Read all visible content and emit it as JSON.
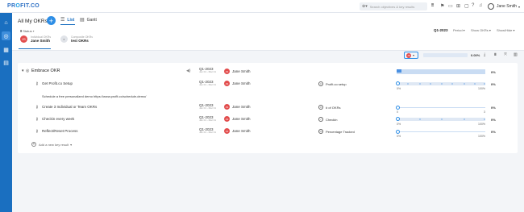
{
  "app": {
    "logo_main": "PR",
    "logo_accent": "O",
    "logo_rest": "FIT.CO"
  },
  "search": {
    "placeholder": "Search objectives & key results"
  },
  "topbar_icons": [
    "filter-icon",
    "flag-icon",
    "folder-icon",
    "grid-icon",
    "chat-icon",
    "help-icon",
    "bell-icon"
  ],
  "user": {
    "name": "Jane Smith"
  },
  "sidebar": {
    "items": [
      "home-icon",
      "target-icon",
      "calendar-icon",
      "message-icon"
    ]
  },
  "header": {
    "title": "All My OKRs",
    "tabs": [
      {
        "label": "List"
      },
      {
        "label": "Gantt"
      }
    ],
    "filter_status": "Status",
    "owners": [
      {
        "label": "Individual OKRs",
        "name": "Jane Smith",
        "initials": "JS"
      },
      {
        "label": "Composite OKRs",
        "name": "test OKRs",
        "initials": ""
      }
    ],
    "period_selected": "Q1-2023",
    "period_label": "Period",
    "show_okrs": "Show OKRs",
    "show_hide": "Show/Hide"
  },
  "toolbar": {
    "mini_initials": "JS",
    "overall_progress": 0,
    "overall_pct": "0.00%"
  },
  "objective": {
    "title": "Embrace OKR",
    "period": "Q1-2023",
    "period_range": "Jan 01 - Mar 31",
    "owner": "Jane Smith",
    "owner_initials": "JS",
    "progress": 0,
    "pct": "0%"
  },
  "key_results": [
    {
      "title": "Get Profit.co Setup",
      "period": "Q1-2023",
      "period_range": "Jan 01 - Mar 31",
      "owner": "Jane Smith",
      "owner_initials": "JS",
      "metric": "Profit.co setup",
      "progress": 0,
      "min": "0%",
      "max": "100%",
      "pct": "0%",
      "note": "Schedule a free personalized demo https://www.profit.co/schedule-demo/"
    },
    {
      "title": "Create 3 Individual or Team OKRs",
      "period": "Q1-2023",
      "period_range": "Jan 01 - Mar 31",
      "owner": "Jane Smith",
      "owner_initials": "JS",
      "metric": "# of OKRs",
      "progress": 0,
      "min": "0",
      "max": "3",
      "pct": "0%"
    },
    {
      "title": "Checkin every week",
      "period": "Q1-2023",
      "period_range": "Jan 01 - Mar 31",
      "owner": "Jane Smith",
      "owner_initials": "JS",
      "metric": "Checkin",
      "progress": 0,
      "min": "0%",
      "max": "100%",
      "pct": "0%"
    },
    {
      "title": "Reflect/Reset Process",
      "period": "Q1-2023",
      "period_range": "Jan 01 - Mar 31",
      "owner": "Jane Smith",
      "owner_initials": "JS",
      "metric": "Percentage Tracked",
      "progress": 0,
      "min": "0%",
      "max": "100%",
      "pct": "0%"
    }
  ],
  "add_kr_label": "Add a new key result",
  "colors": {
    "brand": "#1a6fc0",
    "accent": "#2e8ee6",
    "avatar": "#e24d4d"
  }
}
